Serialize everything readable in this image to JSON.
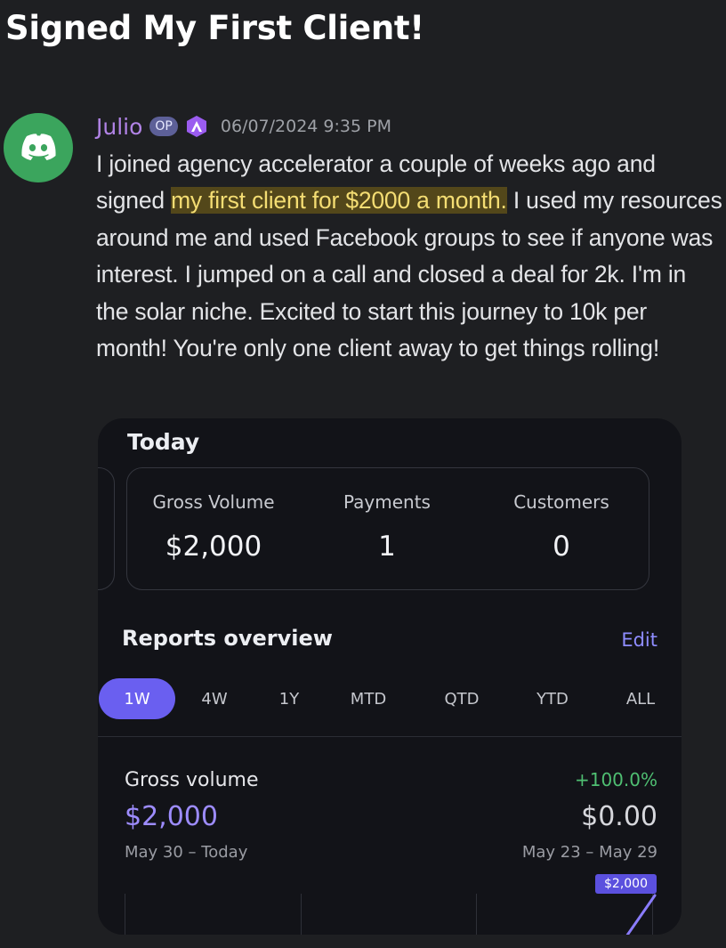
{
  "thread": {
    "title": "Signed My First Client!"
  },
  "message": {
    "author": "Julio",
    "op_badge": "OP",
    "timestamp": "06/07/2024 9:35 PM",
    "avatar_icon": "discord-logo-icon",
    "tag_icon": "triangle-a-badge-icon",
    "text_before": "I joined agency accelerator a couple of weeks ago and signed ",
    "text_highlight": "my first client for $2000 a month.",
    "text_after": " I used my resources around me and used Facebook groups to see if anyone was interest. I jumped on a call and closed a deal for 2k. I'm in the solar niche. Excited to start this journey to 10k per month! You're only one client away to get things rolling!"
  },
  "dashboard": {
    "today_title": "Today",
    "stats": [
      {
        "label": "Gross Volume",
        "value": "$2,000"
      },
      {
        "label": "Payments",
        "value": "1"
      },
      {
        "label": "Customers",
        "value": "0"
      }
    ],
    "reports_title": "Reports overview",
    "edit_label": "Edit",
    "ranges": [
      "1W",
      "4W",
      "1Y",
      "MTD",
      "QTD",
      "YTD",
      "ALL"
    ],
    "active_range": "1W",
    "gross_volume": {
      "label": "Gross volume",
      "value": "$2,000",
      "dates": "May 30 – Today",
      "change": "+100.0%",
      "previous_value": "$0.00",
      "previous_dates": "May 23 – May 29",
      "tooltip": "$2,000"
    }
  },
  "colors": {
    "background": "#1e1f22",
    "author": "#b183e6",
    "highlight_bg": "#53471a",
    "highlight_text": "#f4dd73",
    "accent": "#6a5ff0",
    "positive": "#4fbf72",
    "avatar_bg": "#3ba55d"
  }
}
